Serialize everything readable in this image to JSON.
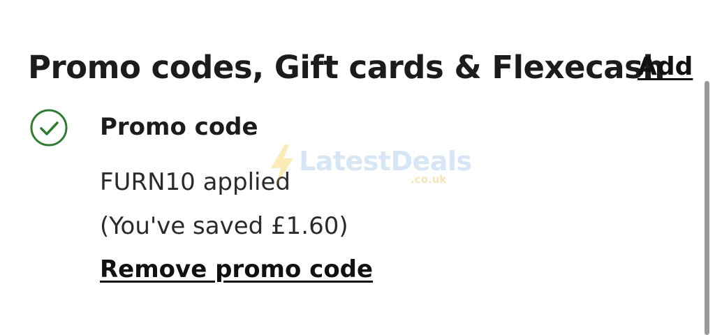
{
  "section": {
    "title": "Promo codes, Gift cards & Flexecash",
    "add_label": "Add"
  },
  "promo": {
    "status_icon": "check-circle-icon",
    "heading": "Promo code",
    "applied_text": "FURN10 applied",
    "saved_text": "(You've saved £1.60)",
    "remove_label": "Remove promo code"
  },
  "watermark": {
    "brand": "LatestDeals",
    "domain": ".co.uk"
  },
  "colors": {
    "success_green": "#2e7d32",
    "text_dark": "#1c1c1c",
    "watermark_blue": "#6fa8dc",
    "watermark_orange": "#e6a600"
  }
}
